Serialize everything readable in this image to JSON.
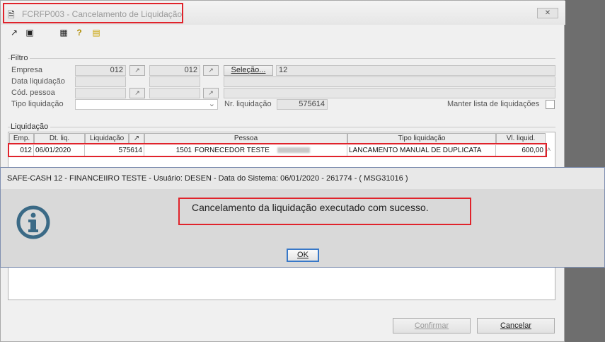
{
  "window": {
    "title": "FCRFP003 - Cancelamento de Liquidação",
    "close_label": "✕"
  },
  "toolbar": {
    "icons": [
      "arrow-export-icon",
      "copy-icon",
      "calendar-grid-icon",
      "help-icon",
      "exit-door-icon"
    ]
  },
  "filtro": {
    "section_label": "Filtro",
    "empresa_label": "Empresa",
    "empresa_from": "012",
    "empresa_to": "012",
    "selecao_label": "Seleção...",
    "selecao_value": "12",
    "data_liq_label": "Data liquidação",
    "cod_pessoa_label": "Cód. pessoa",
    "tipo_liq_label": "Tipo liquidação",
    "nr_liq_label": "Nr. liquidação",
    "nr_liq_value": "575614",
    "manter_label": "Manter lista de liquidações"
  },
  "liquidacao": {
    "section_label": "Liquidação",
    "columns": [
      "Emp.",
      "Dt. liq.",
      "Liquidação",
      "",
      "Pessoa",
      "Tipo liquidação",
      "Vl. liquid."
    ],
    "row": {
      "emp": "012",
      "dt_liq": "06/01/2020",
      "liquidacao": "575614",
      "pessoa_code": "1501",
      "pessoa_name": "FORNECEDOR TESTE",
      "tipo": "LANCAMENTO MANUAL DE DUPLICATA",
      "valor": "600,00"
    }
  },
  "footer": {
    "confirmar_label": "Confirmar",
    "cancelar_label": "Cancelar"
  },
  "dialog": {
    "title": "SAFE-CASH 12 - FINANCEIIRO TESTE - Usuário: DESEN - Data do Sistema: 06/01/2020 - 261774 - ( MSG31016 )",
    "message": "Cancelamento da liquidação executado com sucesso.",
    "ok_label": "OK"
  },
  "colors": {
    "highlight": "#e0232b",
    "info_icon": "#3b6a86",
    "ok_focus": "#3878c8"
  }
}
